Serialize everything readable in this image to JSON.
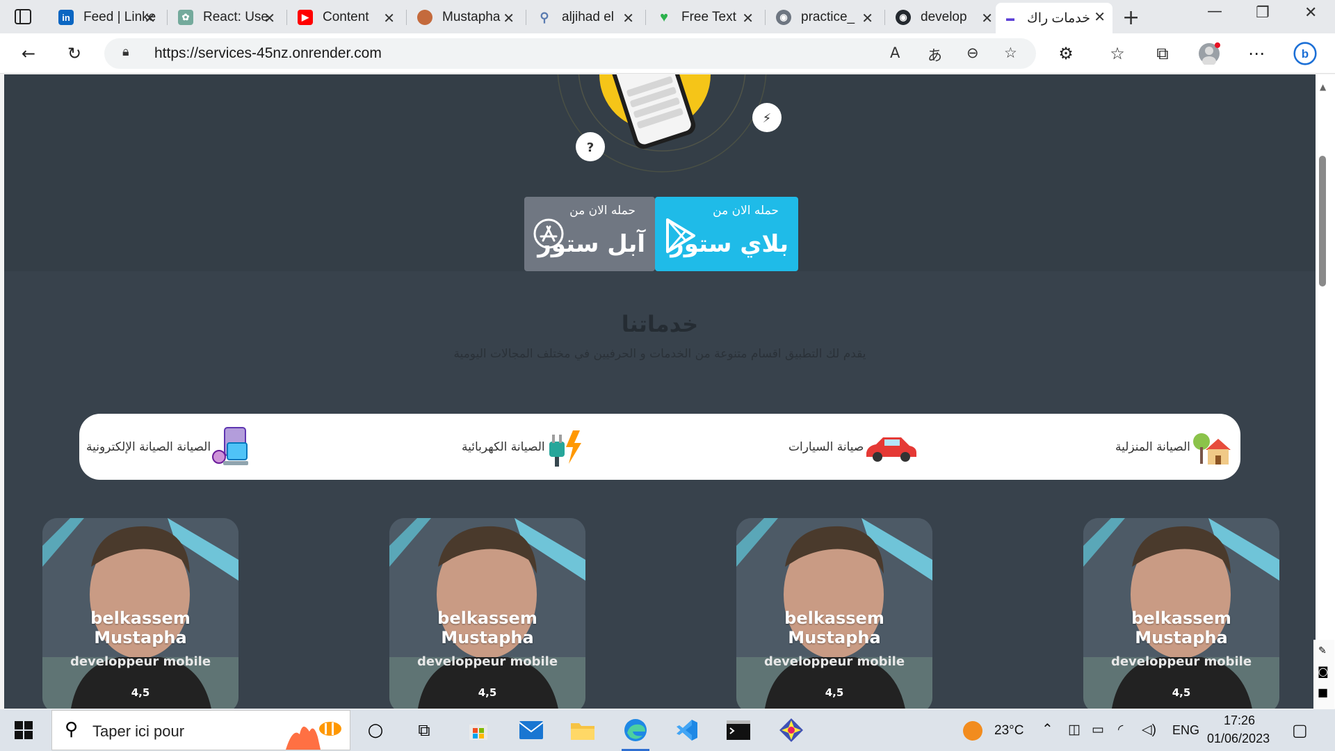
{
  "browser": {
    "tabs": [
      {
        "label": "Feed | LinkedIn",
        "favicon": "linkedin-icon",
        "color": "#0a66c2"
      },
      {
        "label": "React: Use",
        "favicon": "openai-icon",
        "color": "#74aa9c"
      },
      {
        "label": "Content",
        "favicon": "youtube-icon",
        "color": "#ff0000"
      },
      {
        "label": "Mustapha",
        "favicon": "avatar-icon",
        "color": "#c46a3c"
      },
      {
        "label": "aljihad el",
        "favicon": "search-icon",
        "color": "#5a7bb0"
      },
      {
        "label": "Free Text",
        "favicon": "heartbeat-icon",
        "color": "#2bb24c"
      },
      {
        "label": "practice_",
        "favicon": "github-icon",
        "color": "#24292f"
      },
      {
        "label": "develop",
        "favicon": "github-icon",
        "color": "#24292f"
      },
      {
        "label": "خدمات راك",
        "favicon": "site-logo-icon",
        "color": "#5b3fd6"
      }
    ],
    "url": "https://services-45nz.onrender.com"
  },
  "page": {
    "download": {
      "play_small": "حمله الان من",
      "play_big": "بلاي ستور",
      "apple_small": "حمله الان من",
      "apple_big": "آبل ستور"
    },
    "services_title": "خدماتنا",
    "services_subtitle": "يقدم لك التطبيق اقسام متنوعة من الخدمات و الحرفيين في مختلف المجالات اليومية",
    "categories": [
      {
        "label": "الصيانة المنزلية",
        "icon": "house-icon"
      },
      {
        "label": "صيانة السيارات",
        "icon": "car-icon"
      },
      {
        "label": "الصيانة الكهربائية",
        "icon": "electric-plug-icon"
      },
      {
        "label": "الصيانة الصيانة الإلكترونية",
        "icon": "devices-icon"
      }
    ],
    "cards": [
      {
        "name": "belkassem Mustapha",
        "role": "developpeur mobile",
        "rating": "4,5"
      },
      {
        "name": "belkassem Mustapha",
        "role": "developpeur mobile",
        "rating": "4,5"
      },
      {
        "name": "belkassem Mustapha",
        "role": "developpeur mobile",
        "rating": "4,5"
      },
      {
        "name": "belkassem Mustapha",
        "role": "developpeur mobile",
        "rating": "4,5"
      }
    ]
  },
  "taskbar": {
    "search_placeholder": "Taper ici pour",
    "temperature": "23°C",
    "language": "ENG",
    "time": "17:26",
    "date": "01/06/2023"
  },
  "colors": {
    "play_store": "#1fbbe8",
    "apple_store": "#707782",
    "page_bg": "#38424c"
  }
}
